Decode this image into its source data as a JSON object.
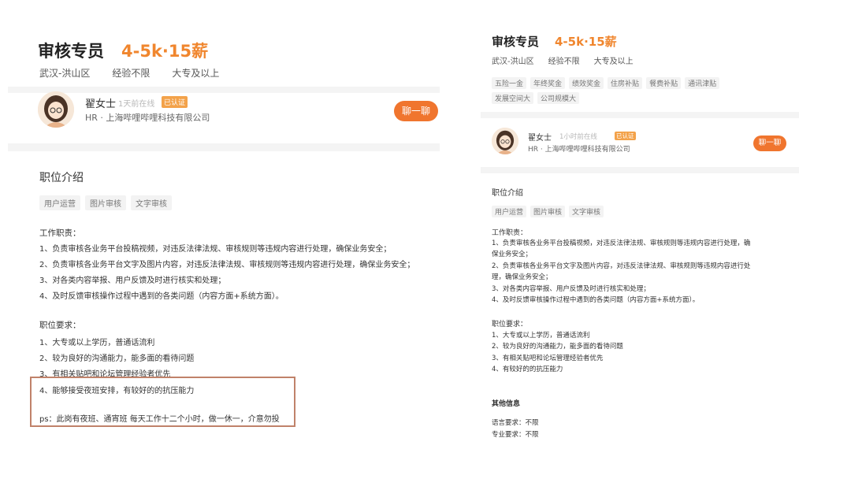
{
  "left": {
    "job_title": "审核专员",
    "salary": "4-5k·15薪",
    "meta": [
      "武汉-洪山区",
      "经验不限",
      "大专及以上"
    ],
    "hr": {
      "name": "翟女士",
      "online": "1天前在线",
      "verified": "已认证",
      "company": "HR · 上海哔哩哔哩科技有限公司",
      "chat_button": "聊一聊"
    },
    "section_title": "职位介绍",
    "tags": [
      "用户运营",
      "图片审核",
      "文字审核"
    ],
    "duties_title": "工作职责：",
    "duties": [
      "1、负责审核各业务平台投稿视频，对违反法律法规、审核规则等违规内容进行处理，确保业务安全；",
      "2、负责审核各业务平台文字及图片内容，对违反法律法规、审核规则等违规内容进行处理，确保业务安全；",
      "3、对各类内容举报、用户反馈及时进行核实和处理；",
      "4、及时反馈审核操作过程中遇到的各类问题（内容方面+系统方面）。"
    ],
    "requirements_title": "职位要求：",
    "requirements": [
      "1、大专或以上学历，普通话流利",
      "2、较为良好的沟通能力，能多面的看待问题",
      "3、有相关贴吧和论坛管理经验者优先",
      "4、能够接受夜班安排，有较好的的抗压能力"
    ],
    "ps": "ps：此岗有夜班、通宵班   每天工作十二个小时，做一休一，介意勿投"
  },
  "right": {
    "job_title": "审核专员",
    "salary": "4-5k·15薪",
    "meta": [
      "武汉-洪山区",
      "经验不限",
      "大专及以上"
    ],
    "benefits_row1": [
      "五险一金",
      "年终奖金",
      "绩效奖金",
      "住房补贴",
      "餐费补贴",
      "通讯津贴"
    ],
    "benefits_row2": [
      "发展空间大",
      "公司规模大"
    ],
    "hr": {
      "name": "翟女士",
      "online": "1小时前在线",
      "verified": "已认证",
      "company": "HR · 上海哔哩哔哩科技有限公司",
      "chat_button": "聊一聊"
    },
    "section_title": "职位介绍",
    "tags": [
      "用户运营",
      "图片审核",
      "文字审核"
    ],
    "duties_title": "工作职责：",
    "duties_lines": [
      "1、负责审核各业务平台投稿视频，对违反法律法规、审核规则等违规内容进行处理，确",
      "保业务安全；",
      "2、负责审核各业务平台文字及图片内容，对违反法律法规、审核规则等违规内容进行处",
      "理，确保业务安全；",
      "3、对各类内容举报、用户反馈及时进行核实和处理；",
      "4、及时反馈审核操作过程中遇到的各类问题（内容方面+系统方面）。"
    ],
    "requirements_title": "职位要求：",
    "requirements": [
      "1、大专或以上学历，普通话流利",
      "2、较为良好的沟通能力，能多面的看待问题",
      "3、有相关贴吧和论坛管理经验者优先",
      "4、有较好的的抗压能力"
    ],
    "other_title": "其他信息",
    "other": [
      "语言要求：不限",
      "专业要求：不限"
    ]
  },
  "colors": {
    "salary": "#f0862e",
    "chat_button": "#f0752e",
    "verified_badge": "#f3a24a",
    "highlight_border": "#c0826a"
  },
  "icons": [
    "avatar-illustration"
  ]
}
